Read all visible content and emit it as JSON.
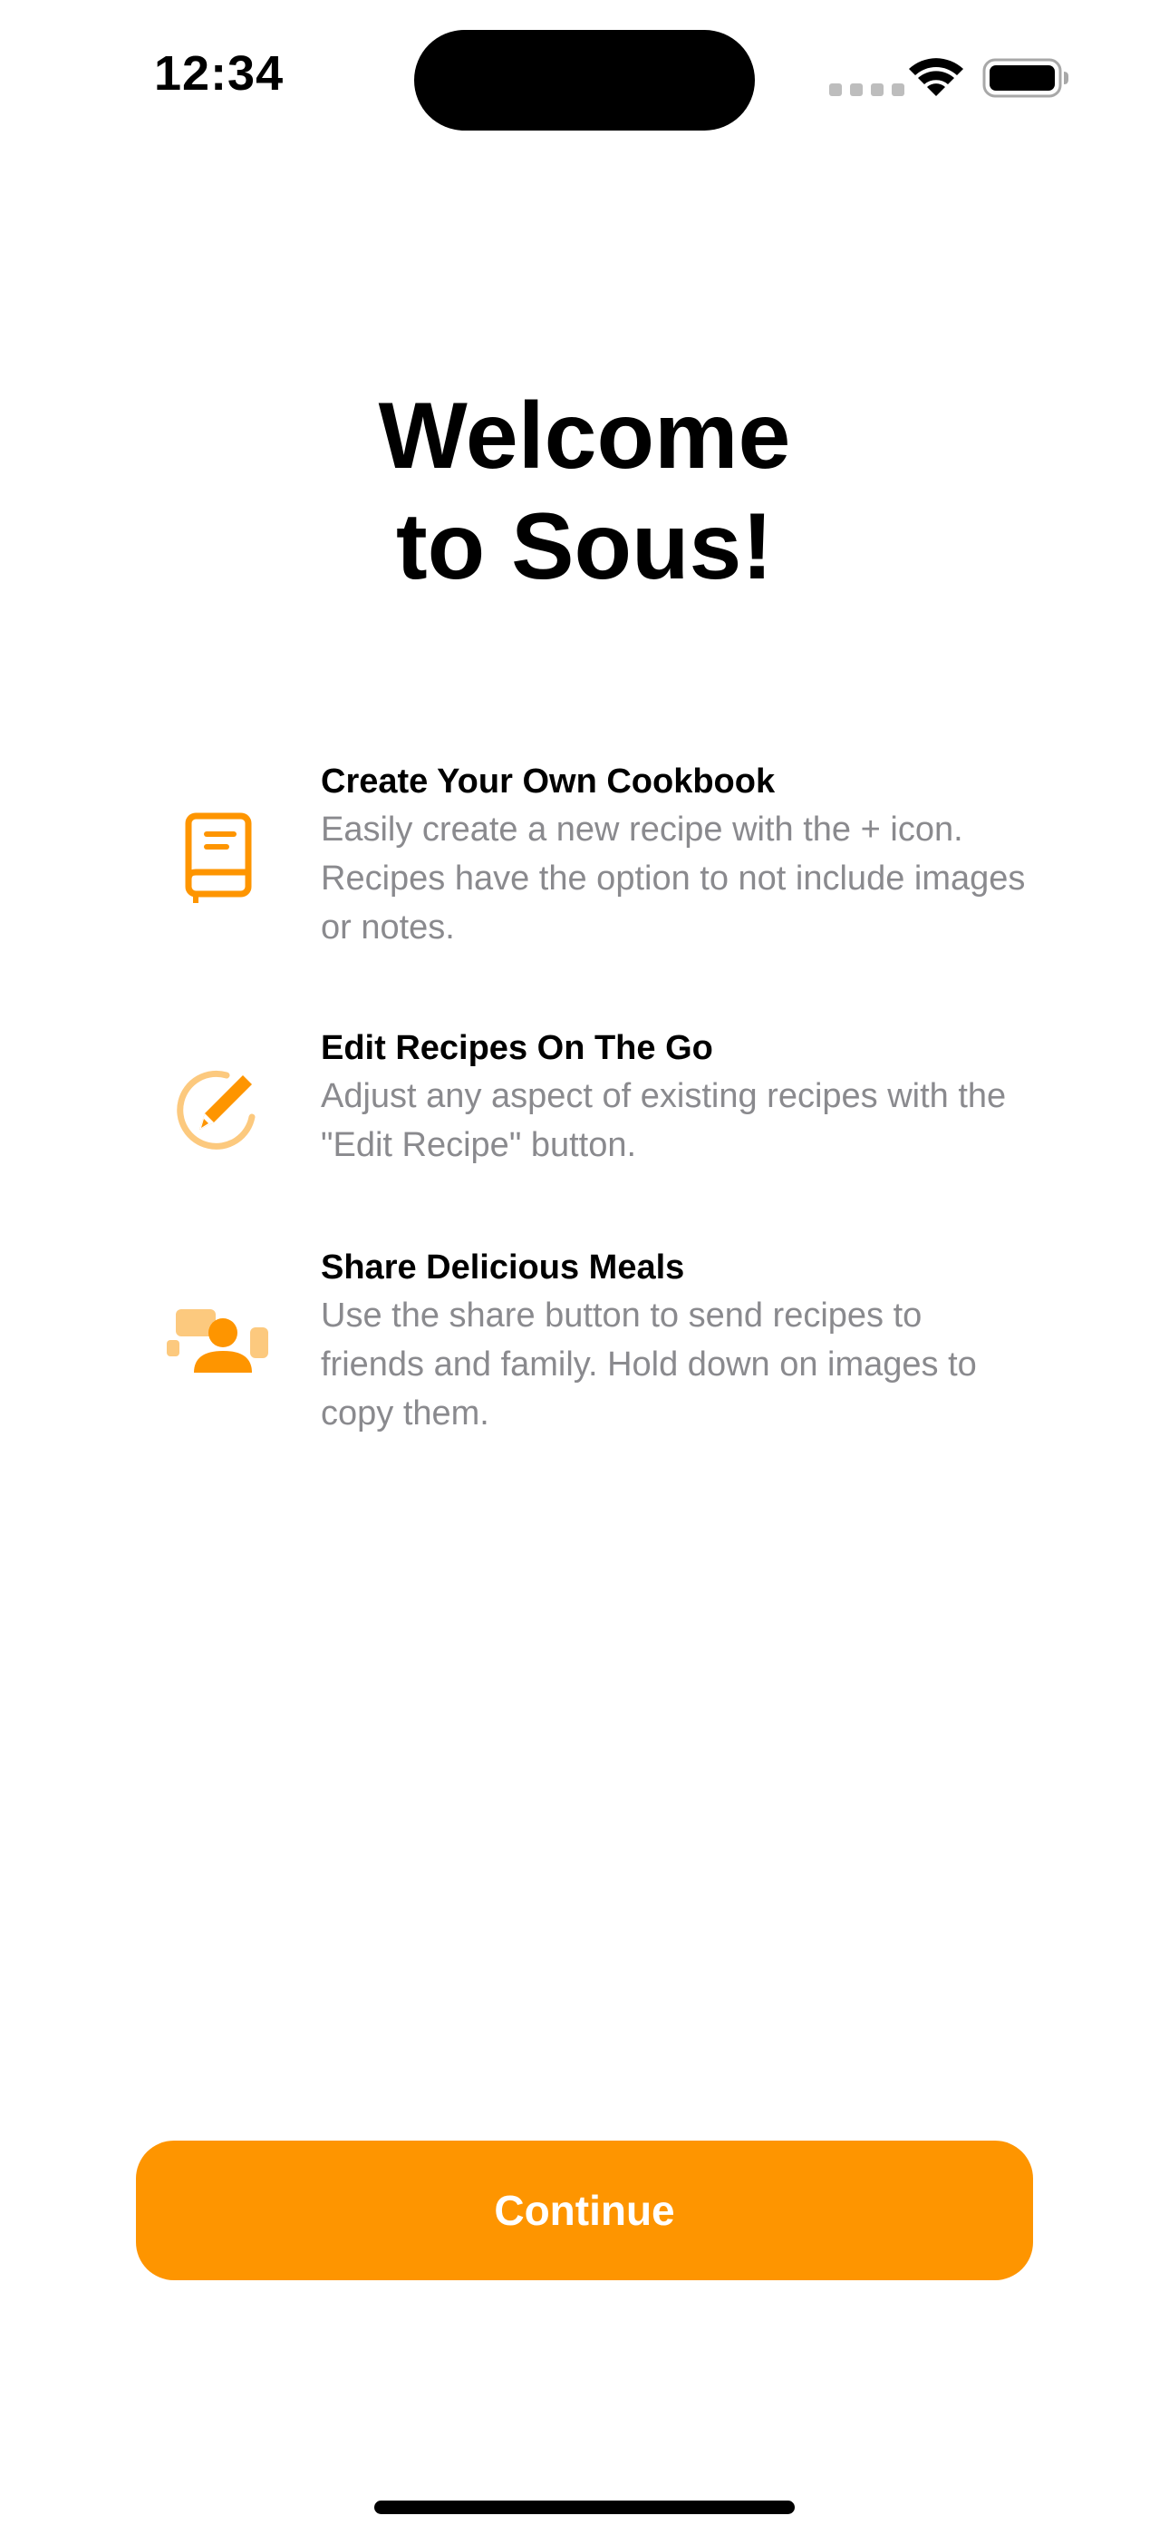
{
  "status_bar": {
    "time": "12:34"
  },
  "title": {
    "line1": "Welcome",
    "line2": "to Sous!"
  },
  "features": [
    {
      "icon": "book-icon",
      "title": "Create Your Own Cookbook",
      "description": "Easily create a new recipe with the + icon. Recipes have the option to not include images or notes."
    },
    {
      "icon": "pencil-circle-icon",
      "title": "Edit Recipes On The Go",
      "description": "Adjust any aspect of existing recipes with the \"Edit Recipe\" button."
    },
    {
      "icon": "person-share-icon",
      "title": "Share Delicious Meals",
      "description": "Use the share button to send recipes to friends and family. Hold down on images to copy them."
    }
  ],
  "continue_button": {
    "label": "Continue"
  },
  "colors": {
    "accent": "#fe9500",
    "accent_light": "#fcc97e",
    "secondary_text": "#8a8a8e"
  }
}
